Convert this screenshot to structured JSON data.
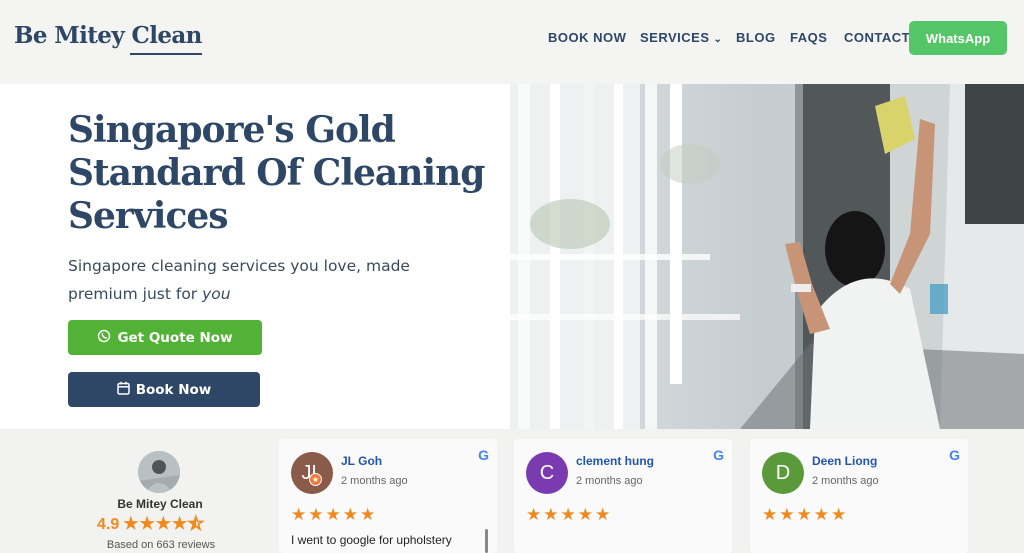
{
  "header": {
    "logo_text": "Be Mitey Clean",
    "nav": [
      {
        "label": "BOOK NOW"
      },
      {
        "label": "SERVICES"
      },
      {
        "label": "BLOG"
      },
      {
        "label": "FAQS"
      },
      {
        "label": "CONTACT"
      }
    ],
    "whatsapp_label": "WhatsApp"
  },
  "hero": {
    "title": "Singapore's Gold Standard Of Cleaning Services",
    "subtitle_main": "Singapore cleaning services you love, made premium just for ",
    "subtitle_em": "you",
    "quote_button": "Get Quote Now",
    "book_button": "Book Now"
  },
  "reviews": {
    "business_name": "Be Mitey Clean",
    "rating": "4.9",
    "rating_value": 4.5,
    "count_text": "Based on 663 reviews",
    "items": [
      {
        "initials": "JL",
        "name": "JL Goh",
        "date": "2 months ago",
        "rating": 5,
        "text": "I went to google for upholstery",
        "avatar_color": "#8a5a4a"
      },
      {
        "initials": "C",
        "name": "clement hung",
        "date": "2 months ago",
        "rating": 5,
        "text": "",
        "avatar_color": "#7a3bb0"
      },
      {
        "initials": "D",
        "name": "Deen Liong",
        "date": "2 months ago",
        "rating": 5,
        "text": "",
        "avatar_color": "#5a9a3a"
      }
    ]
  },
  "colors": {
    "brand_navy": "#2f4766",
    "whatsapp_green": "#55c667",
    "quote_green": "#52b236",
    "star_orange": "#f08a1e",
    "link_blue": "#2255b0"
  }
}
